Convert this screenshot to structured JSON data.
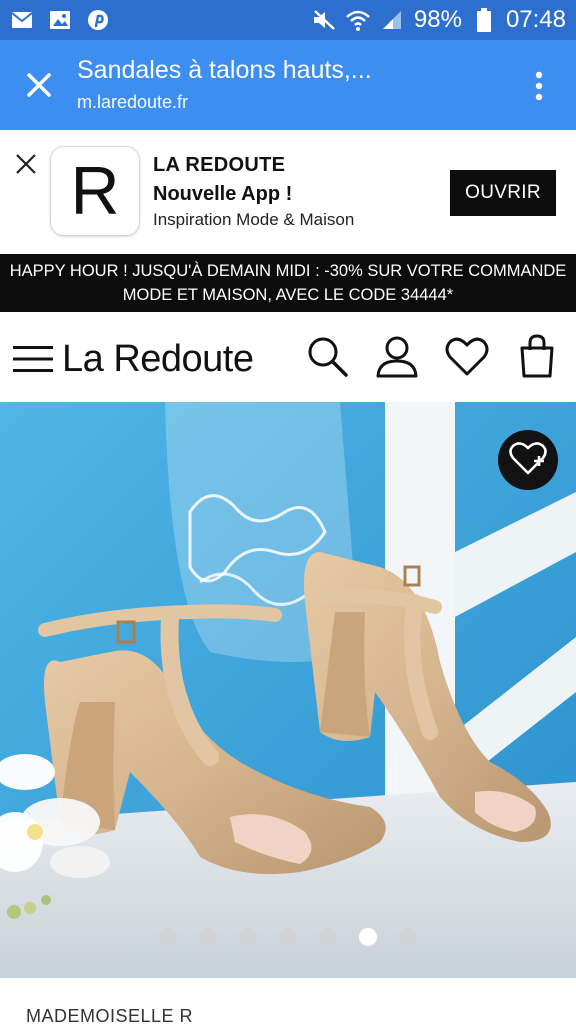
{
  "status_bar": {
    "icons": [
      "email-icon",
      "image-icon",
      "pinterest-icon",
      "mute-icon",
      "wifi-icon",
      "signal-icon",
      "battery-icon"
    ],
    "battery": "98%",
    "time": "07:48"
  },
  "toolbar": {
    "title": "Sandales à talons hauts,...",
    "url": "m.laredoute.fr"
  },
  "app_banner": {
    "logo_letter": "R",
    "name": "LA REDOUTE",
    "subtitle": "Nouvelle App !",
    "description": "Inspiration Mode & Maison",
    "open_label": "OUVRIR"
  },
  "promo": {
    "line1": "HAPPY HOUR ! JUSQU'À DEMAIN MIDI : -30% SUR VOTRE COMMANDE",
    "line2": "MODE ET MAISON, AVEC LE CODE 34444*"
  },
  "header": {
    "brand": "La Redoute",
    "icons": [
      "menu-icon",
      "search-icon",
      "account-icon",
      "wishlist-icon",
      "bag-icon"
    ]
  },
  "product": {
    "brand": "MADEMOISELLE R",
    "carousel": {
      "count": 7,
      "active_index": 5
    }
  },
  "colors": {
    "status_bar": "#2d6fcf",
    "toolbar": "#3d8ef0",
    "promo_bg": "#0c0c0c",
    "hero_bg": "#3aa2d6"
  }
}
